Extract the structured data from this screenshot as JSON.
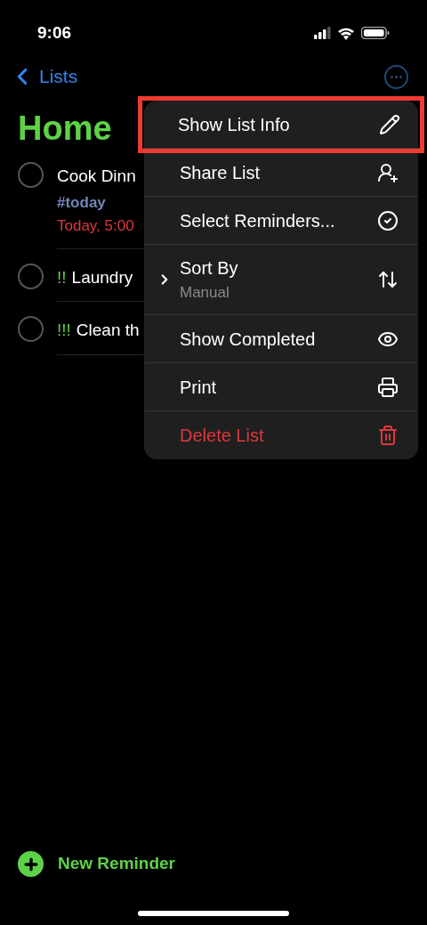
{
  "status_bar": {
    "time": "9:06"
  },
  "nav": {
    "back_label": "Lists"
  },
  "list_title": "Home",
  "reminders": [
    {
      "checked": false,
      "title": "Cook Dinn",
      "tag": "#today",
      "due": "Today, 5:00"
    },
    {
      "checked": false,
      "priority": "!!",
      "title": "Laundry"
    },
    {
      "checked": false,
      "priority": "!!!",
      "title": "Clean th"
    }
  ],
  "menu": [
    {
      "kind": "action",
      "label": "Show List Info",
      "highlighted": true
    },
    {
      "kind": "action",
      "label": "Share List",
      "highlighted": false
    },
    {
      "kind": "action",
      "label": "Select Reminders...",
      "highlighted": false
    },
    {
      "kind": "submenu",
      "label": "Sort By",
      "subtitle": "Manual",
      "highlighted": false
    },
    {
      "kind": "action",
      "label": "Show Completed",
      "highlighted": false
    },
    {
      "kind": "action",
      "label": "Print",
      "highlighted": false
    },
    {
      "kind": "destructive",
      "label": "Delete List",
      "highlighted": false
    }
  ],
  "new_reminder": "New Reminder"
}
